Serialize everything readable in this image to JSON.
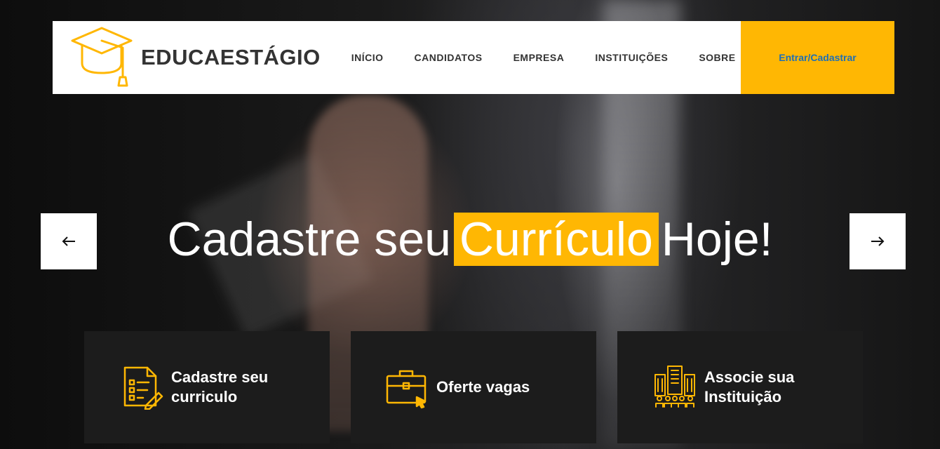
{
  "brand": {
    "name": "EDUCAESTÁGIO",
    "logo_icon": "graduation-cap-icon",
    "accent_color": "#ffb703"
  },
  "nav": {
    "items": [
      {
        "label": "INÍCIO"
      },
      {
        "label": "CANDIDATOS"
      },
      {
        "label": "EMPRESA"
      },
      {
        "label": "INSTITUIÇÕES"
      },
      {
        "label": "SOBRE"
      }
    ],
    "cta_label": "Entrar/Cadastrar"
  },
  "hero": {
    "before": "Cadastre seu",
    "highlight": "Currículo",
    "after": "Hoje!",
    "prev_icon": "arrow-left-icon",
    "next_icon": "arrow-right-icon"
  },
  "cards": [
    {
      "line1": "Cadastre seu",
      "line2": "curriculo",
      "icon": "resume-document-icon"
    },
    {
      "line1": "Oferte vagas",
      "line2": "",
      "icon": "briefcase-icon"
    },
    {
      "line1": "Associe sua",
      "line2": "Instituição",
      "icon": "building-people-icon"
    }
  ]
}
